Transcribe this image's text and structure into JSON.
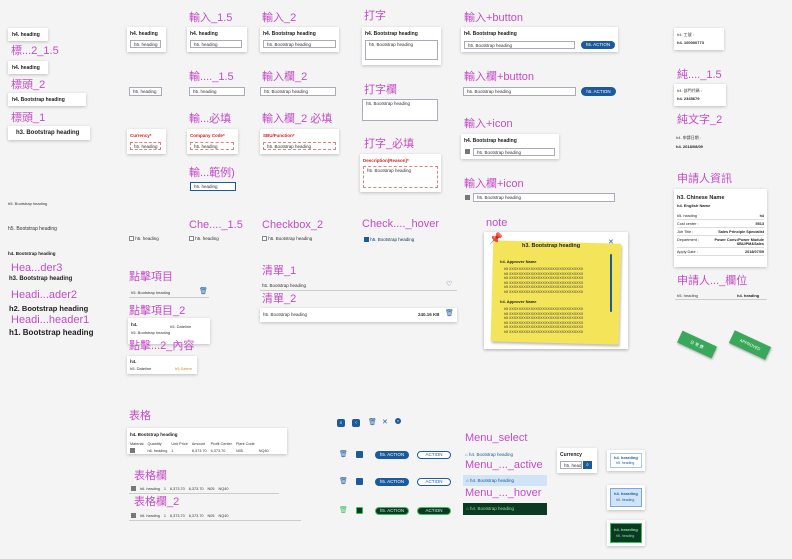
{
  "labels": {
    "col1": [
      "標...2_1.5",
      "標頭_2",
      "標頭_1",
      "Hea...der3",
      "Headi...ader2",
      "Headi...header1"
    ],
    "col2": [
      "輸入_1.5",
      "輸...._1.5",
      "輸...必填",
      "輸...範例)",
      "Che...._1.5",
      "點擊項目",
      "點擊項目_2",
      "點擊...2_內容",
      "表格",
      "表格欄",
      "表格欄_2"
    ],
    "col3": [
      "輸入_2",
      "輸入欄_2",
      "輸入欄_2 必填",
      "Checkbox_2",
      "清單_1",
      "清單_2"
    ],
    "col4": [
      "打字",
      "打字欄",
      "打字_必填",
      "Check...._hover"
    ],
    "col5": [
      "輸入+button",
      "輸入欄+button",
      "輸入+icon",
      "輸入欄+icon",
      "note",
      "Menu_select",
      "Menu_..._active",
      "Menu_..._hover"
    ],
    "col6": [
      "純...._1.5",
      "純文字_2",
      "申請人資訊",
      "申請人..._欄位"
    ]
  },
  "text": {
    "h4": "h4. heading",
    "h5": "h5. heading",
    "h4_bs": "h4. Bootstrap heading",
    "h5_bs": "h5. Bootstrap heading",
    "h3_bs": "h3. Bootstrap heading",
    "h2_bs": "h2. Bootstrap heading",
    "h1_bs": "h1. Bootstrap heading",
    "h4_label": "h4.",
    "h5_dateline": "h5. Dateline",
    "h5_salem": "h5.Salem",
    "size": "240.16 KB",
    "action": "h5. ACTION",
    "action_plain": "ACTION",
    "currency_req": "Currency*",
    "company_req": "Company Code*",
    "sbu_req": "SBU/Function*",
    "desc_req": "Description(Reason)*",
    "currency": "Currency"
  },
  "plain_text": {
    "a_label": "h4. 工號 :",
    "a_value": "h4. 100000773",
    "b_label": "h4. 部門代碼 :",
    "b_value": "h4. 2345679",
    "c_label": "h4. 申請日期 :",
    "c_value": "h4. 2018/08/09"
  },
  "applicant": {
    "title": "h3. Chinese Name",
    "subtitle": "h4. English Name",
    "rows": [
      {
        "k": "h5. heading",
        "v": "h4"
      },
      {
        "k": "Cost center :",
        "v": "5513"
      },
      {
        "k": "Job Title :",
        "v": "Sales Principle Specialist"
      },
      {
        "k": "Department :",
        "v": "Power Conv./Power Module SBU/PM&Sales"
      },
      {
        "k": "Apply Date :",
        "v": "2018/07/09"
      }
    ],
    "field_label": "h5. heading",
    "field_value": "h4. heading"
  },
  "note": {
    "title": "h3. Bootstrap heading",
    "section1": "h4. Approver Name",
    "section2": "h4. Approver Name",
    "line": "h5 XXXXXXXXXXXXXXXXXXXXXXXXXXXXXXX"
  },
  "table": {
    "title": "h4. Bootstrap heading",
    "headers": [
      "Material",
      "Quantity",
      "Unit Price",
      "Amount",
      "Profit Center",
      "Plant Code"
    ],
    "row": [
      "h6. heading",
      "1",
      "6,373.70",
      "6,373.70",
      "N05",
      "NQ40"
    ]
  },
  "menu": {
    "label": "h4. Bootstrap heading",
    "card_title": "h4. hearding",
    "card_sub": "h5. heading"
  },
  "tags": {
    "a": "日 常 費",
    "b": "APPROVED"
  },
  "colors": {
    "accent": "#1b5a9c",
    "label": "#c44bc8",
    "required": "#d81e1e",
    "dark_green": "#0a3a22"
  }
}
